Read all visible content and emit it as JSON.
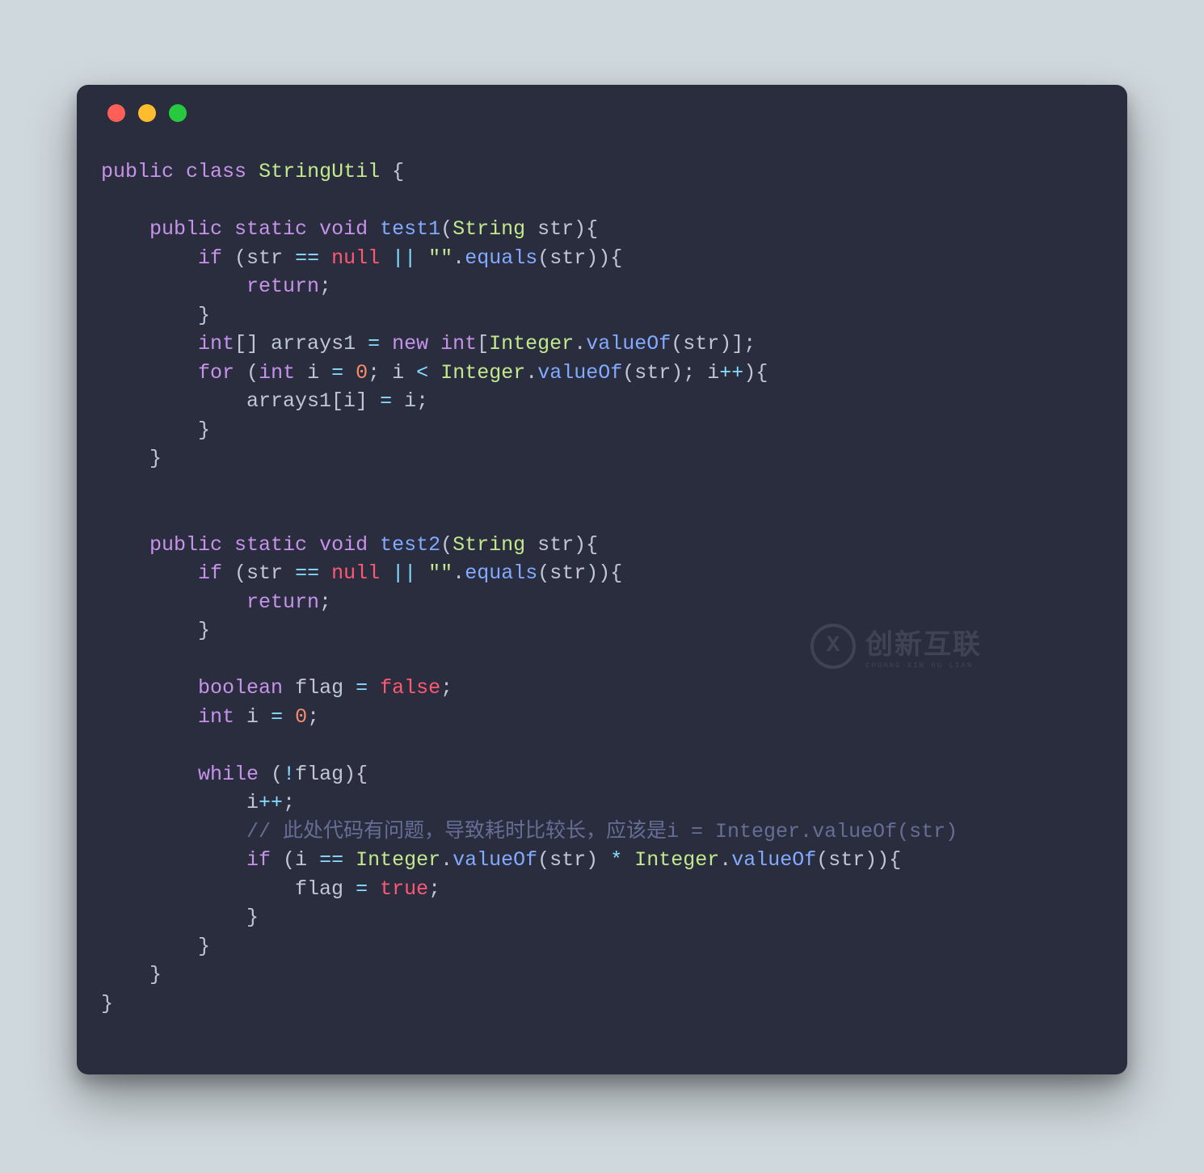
{
  "colors": {
    "bg_page": "#cfd8dc",
    "bg_window": "#292d3e",
    "dot_red": "#ff5f56",
    "dot_yellow": "#ffbd2e",
    "dot_green": "#27c93f",
    "text_default": "#bfc7d5",
    "keyword": "#c792ea",
    "type": "#c3e88d",
    "function": "#82aaff",
    "operator": "#89ddff",
    "string": "#c3e88d",
    "number": "#f78c6c",
    "literal": "#ff5874",
    "comment": "#676e95"
  },
  "watermark": {
    "icon_letter": "X",
    "title": "创新互联",
    "subtitle": "CHUANG XIN HU LIAN"
  },
  "code": {
    "tokens": [
      {
        "c": "kw",
        "t": "public"
      },
      {
        "t": " "
      },
      {
        "c": "kw",
        "t": "class"
      },
      {
        "t": " "
      },
      {
        "c": "type",
        "t": "StringUtil"
      },
      {
        "t": " {"
      },
      {
        "nl": 1
      },
      {
        "nl": 1
      },
      {
        "t": "    "
      },
      {
        "c": "kw",
        "t": "public"
      },
      {
        "t": " "
      },
      {
        "c": "kw",
        "t": "static"
      },
      {
        "t": " "
      },
      {
        "c": "kw",
        "t": "void"
      },
      {
        "t": " "
      },
      {
        "c": "fn",
        "t": "test1"
      },
      {
        "t": "("
      },
      {
        "c": "type",
        "t": "String"
      },
      {
        "t": " str){"
      },
      {
        "nl": 1
      },
      {
        "t": "        "
      },
      {
        "c": "kw",
        "t": "if"
      },
      {
        "t": " (str "
      },
      {
        "c": "op",
        "t": "=="
      },
      {
        "t": " "
      },
      {
        "c": "lit",
        "t": "null"
      },
      {
        "t": " "
      },
      {
        "c": "op",
        "t": "||"
      },
      {
        "t": " "
      },
      {
        "c": "str",
        "t": "\"\""
      },
      {
        "t": "."
      },
      {
        "c": "fn",
        "t": "equals"
      },
      {
        "t": "(str)){"
      },
      {
        "nl": 1
      },
      {
        "t": "            "
      },
      {
        "c": "kw",
        "t": "return"
      },
      {
        "t": ";"
      },
      {
        "nl": 1
      },
      {
        "t": "        }"
      },
      {
        "nl": 1
      },
      {
        "t": "        "
      },
      {
        "c": "kw",
        "t": "int"
      },
      {
        "t": "[] arrays1 "
      },
      {
        "c": "op",
        "t": "="
      },
      {
        "t": " "
      },
      {
        "c": "kw",
        "t": "new"
      },
      {
        "t": " "
      },
      {
        "c": "kw",
        "t": "int"
      },
      {
        "t": "["
      },
      {
        "c": "type",
        "t": "Integer"
      },
      {
        "t": "."
      },
      {
        "c": "fn",
        "t": "valueOf"
      },
      {
        "t": "(str)];"
      },
      {
        "nl": 1
      },
      {
        "t": "        "
      },
      {
        "c": "kw",
        "t": "for"
      },
      {
        "t": " ("
      },
      {
        "c": "kw",
        "t": "int"
      },
      {
        "t": " i "
      },
      {
        "c": "op",
        "t": "="
      },
      {
        "t": " "
      },
      {
        "c": "num",
        "t": "0"
      },
      {
        "t": "; i "
      },
      {
        "c": "op",
        "t": "<"
      },
      {
        "t": " "
      },
      {
        "c": "type",
        "t": "Integer"
      },
      {
        "t": "."
      },
      {
        "c": "fn",
        "t": "valueOf"
      },
      {
        "t": "(str); i"
      },
      {
        "c": "op",
        "t": "++"
      },
      {
        "t": "){"
      },
      {
        "nl": 1
      },
      {
        "t": "            arrays1[i] "
      },
      {
        "c": "op",
        "t": "="
      },
      {
        "t": " i;"
      },
      {
        "nl": 1
      },
      {
        "t": "        }"
      },
      {
        "nl": 1
      },
      {
        "t": "    }"
      },
      {
        "nl": 1
      },
      {
        "nl": 1
      },
      {
        "nl": 1
      },
      {
        "t": "    "
      },
      {
        "c": "kw",
        "t": "public"
      },
      {
        "t": " "
      },
      {
        "c": "kw",
        "t": "static"
      },
      {
        "t": " "
      },
      {
        "c": "kw",
        "t": "void"
      },
      {
        "t": " "
      },
      {
        "c": "fn",
        "t": "test2"
      },
      {
        "t": "("
      },
      {
        "c": "type",
        "t": "String"
      },
      {
        "t": " str){"
      },
      {
        "nl": 1
      },
      {
        "t": "        "
      },
      {
        "c": "kw",
        "t": "if"
      },
      {
        "t": " (str "
      },
      {
        "c": "op",
        "t": "=="
      },
      {
        "t": " "
      },
      {
        "c": "lit",
        "t": "null"
      },
      {
        "t": " "
      },
      {
        "c": "op",
        "t": "||"
      },
      {
        "t": " "
      },
      {
        "c": "str",
        "t": "\"\""
      },
      {
        "t": "."
      },
      {
        "c": "fn",
        "t": "equals"
      },
      {
        "t": "(str)){"
      },
      {
        "nl": 1
      },
      {
        "t": "            "
      },
      {
        "c": "kw",
        "t": "return"
      },
      {
        "t": ";"
      },
      {
        "nl": 1
      },
      {
        "t": "        }"
      },
      {
        "nl": 1
      },
      {
        "nl": 1
      },
      {
        "t": "        "
      },
      {
        "c": "kw",
        "t": "boolean"
      },
      {
        "t": " flag "
      },
      {
        "c": "op",
        "t": "="
      },
      {
        "t": " "
      },
      {
        "c": "lit",
        "t": "false"
      },
      {
        "t": ";"
      },
      {
        "nl": 1
      },
      {
        "t": "        "
      },
      {
        "c": "kw",
        "t": "int"
      },
      {
        "t": " i "
      },
      {
        "c": "op",
        "t": "="
      },
      {
        "t": " "
      },
      {
        "c": "num",
        "t": "0"
      },
      {
        "t": ";"
      },
      {
        "nl": 1
      },
      {
        "nl": 1
      },
      {
        "t": "        "
      },
      {
        "c": "kw",
        "t": "while"
      },
      {
        "t": " ("
      },
      {
        "c": "op",
        "t": "!"
      },
      {
        "t": "flag){"
      },
      {
        "nl": 1
      },
      {
        "t": "            i"
      },
      {
        "c": "op",
        "t": "++"
      },
      {
        "t": ";"
      },
      {
        "nl": 1
      },
      {
        "t": "            "
      },
      {
        "c": "cmt",
        "t": "// 此处代码有问题，导致耗时比较长，应该是i = Integer.valueOf(str)"
      },
      {
        "nl": 1
      },
      {
        "t": "            "
      },
      {
        "c": "kw",
        "t": "if"
      },
      {
        "t": " (i "
      },
      {
        "c": "op",
        "t": "=="
      },
      {
        "t": " "
      },
      {
        "c": "type",
        "t": "Integer"
      },
      {
        "t": "."
      },
      {
        "c": "fn",
        "t": "valueOf"
      },
      {
        "t": "(str) "
      },
      {
        "c": "op",
        "t": "*"
      },
      {
        "t": " "
      },
      {
        "c": "type",
        "t": "Integer"
      },
      {
        "t": "."
      },
      {
        "c": "fn",
        "t": "valueOf"
      },
      {
        "t": "(str)){"
      },
      {
        "nl": 1
      },
      {
        "t": "                flag "
      },
      {
        "c": "op",
        "t": "="
      },
      {
        "t": " "
      },
      {
        "c": "lit",
        "t": "true"
      },
      {
        "t": ";"
      },
      {
        "nl": 1
      },
      {
        "t": "            }"
      },
      {
        "nl": 1
      },
      {
        "t": "        }"
      },
      {
        "nl": 1
      },
      {
        "t": "    }"
      },
      {
        "nl": 1
      },
      {
        "t": "}"
      }
    ]
  }
}
